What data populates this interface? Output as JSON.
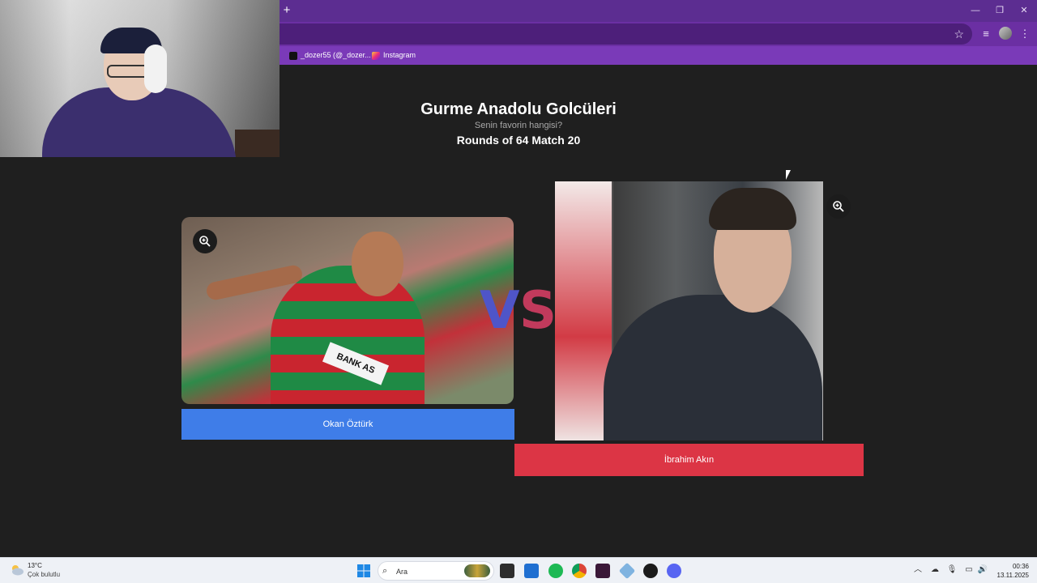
{
  "browser": {
    "new_tab_glyph": "+",
    "window_controls": {
      "minimize": "—",
      "restore": "❐",
      "close": "✕"
    },
    "toolbar_icons": [
      "star-icon",
      "media-queue-icon",
      "profile-avatar",
      "kebab-menu-icon"
    ],
    "bookmarks": [
      {
        "label": "_dozer55 (@_dozer...",
        "icon": "tiktok-icon",
        "color": "#111111"
      },
      {
        "label": "Instagram",
        "icon": "instagram-icon",
        "color": "#e1306c"
      }
    ],
    "accent": "#6b2fa3"
  },
  "page": {
    "title": "Gurme Anadolu Golcüleri",
    "subtitle": "Senin favorin hangisi?",
    "round": "Rounds of 64 Match 20",
    "vs_left": "V",
    "vs_right": "S",
    "vs_colors": {
      "left": "#4f55c8",
      "right": "#c13a5c"
    },
    "left_player": {
      "name": "Okan Öztürk",
      "jersey_text": "BANK AS",
      "button_color": "#3f7de8"
    },
    "right_player": {
      "name": "İbrahim Akın",
      "button_color": "#dc3545"
    }
  },
  "taskbar": {
    "weather": {
      "temp": "13°C",
      "desc": "Çok bulutlu"
    },
    "search_placeholder": "Ara",
    "apps": [
      "windows-start-icon",
      "file-explorer-icon",
      "store-icon",
      "spotify-icon",
      "chrome-icon",
      "app-icon",
      "network-app-icon",
      "steam-icon",
      "discord-icon"
    ],
    "tray_icons": [
      "chevron-up-icon",
      "cloud-icon",
      "microphone-icon",
      "display-icon",
      "speaker-icon"
    ],
    "clock": {
      "time": "00:36",
      "date": "13.11.2025"
    }
  }
}
